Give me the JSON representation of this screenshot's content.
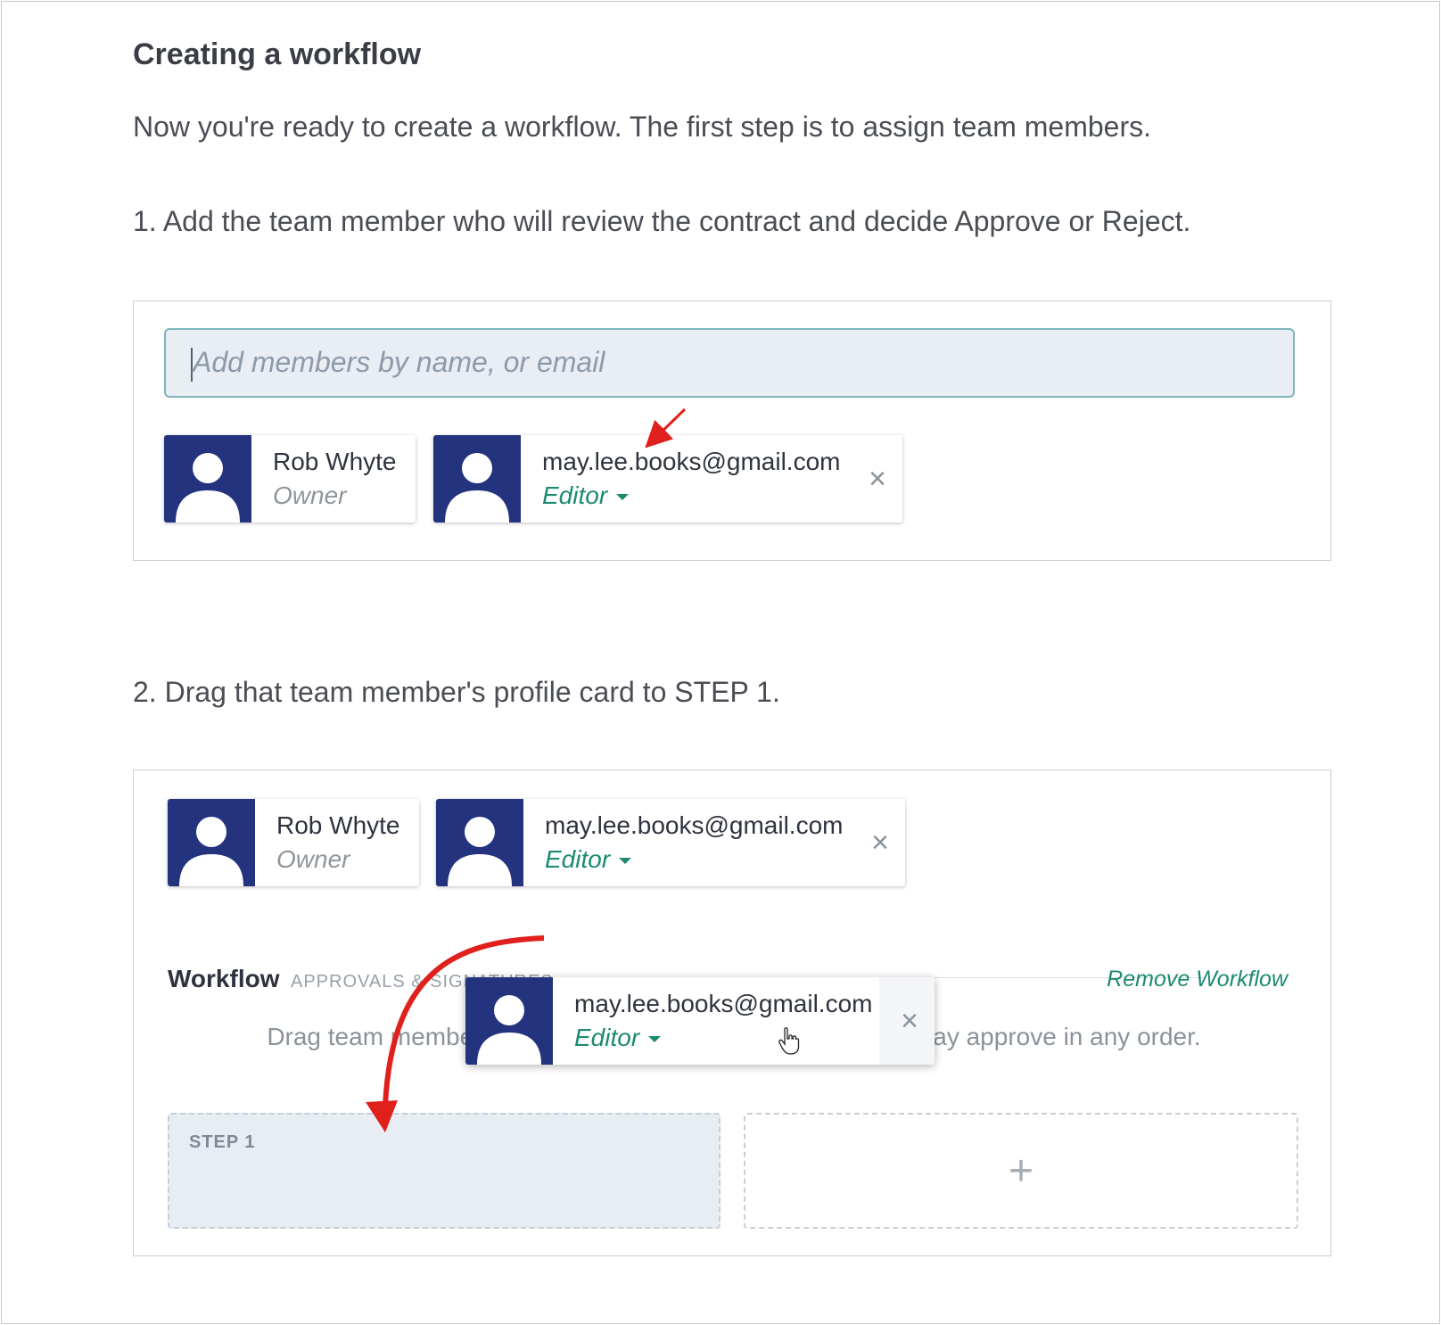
{
  "heading": "Creating a workflow",
  "intro": "Now you're ready to create a workflow. The first step is to assign team members.",
  "step1_text": "1. Add the team member who will review the contract and decide Approve or Reject.",
  "step2_text": "2. Drag that team member's profile card to STEP 1.",
  "members_input": {
    "placeholder": "Add members by name, or email"
  },
  "members": [
    {
      "name": "Rob Whyte",
      "role": "Owner"
    },
    {
      "name": "may.lee.books@gmail.com",
      "role": "Editor"
    }
  ],
  "workflow": {
    "label": "Workflow",
    "sub_label": "APPROVALS & SIGNATURES",
    "remove_label": "Remove Workflow",
    "description": "Drag team members to a step. Members in the same step may approve in any order.",
    "step_label": "STEP 1",
    "add_step_symbol": "+"
  },
  "dragging_card": {
    "name": "may.lee.books@gmail.com",
    "role": "Editor"
  },
  "icons": {
    "close": "×",
    "dropdown": "caret-down-icon",
    "cursor": "hand-pointer-icon",
    "avatar": "person-icon"
  },
  "colors": {
    "accent_green": "#1d8a72",
    "avatar_navy": "#23337e",
    "annotation_red": "#e0201c",
    "input_border": "#7fb7bb"
  }
}
